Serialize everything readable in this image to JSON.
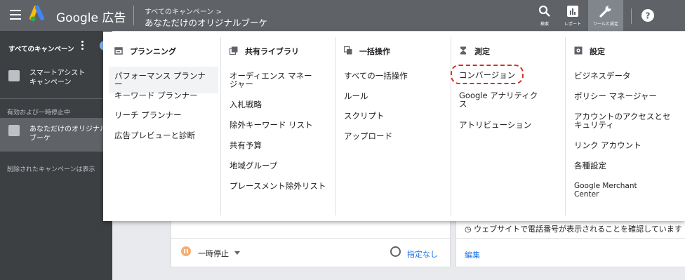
{
  "header": {
    "app_name": "Google 広告",
    "breadcrumb_parent": "すべてのキャンペーン >",
    "breadcrumb_current": "あなただけのオリジナルブーケ",
    "tools": [
      {
        "label": "検索",
        "icon": "search-icon"
      },
      {
        "label": "レポート",
        "icon": "bar-chart-icon"
      },
      {
        "label": "ツールと設定",
        "icon": "wrench-icon"
      }
    ],
    "help_icon": "help-icon"
  },
  "sidebar": {
    "all_campaigns": "すべてのキャンペーン",
    "smart_campaign": "スマートアシスト\nキャンペーン",
    "section_label": "有効および一時停止中",
    "campaign_name": "あなただけのオリジナル\nブーケ",
    "deleted_hidden": "削除されたキャンペーンは表示"
  },
  "background": {
    "pause_label": "一時停止",
    "schedule_label": "指定なし",
    "phone_notice": "◷ ウェブサイトで電話番号が表示されることを確認しています",
    "edit_link": "編集"
  },
  "menu": {
    "planning": {
      "title": "プランニング",
      "items": [
        "パフォーマンス プランナー",
        "キーワード プランナー",
        "リーチ プランナー",
        "広告プレビューと診断"
      ]
    },
    "shared_library": {
      "title": "共有ライブラリ",
      "items": [
        "オーディエンス マネー\nジャー",
        "入札戦略",
        "除外キーワード リスト",
        "共有予算",
        "地域グループ",
        "プレースメント除外リスト"
      ]
    },
    "bulk_actions": {
      "title": "一括操作",
      "items": [
        "すべての一括操作",
        "ルール",
        "スクリプト",
        "アップロード"
      ]
    },
    "measurement": {
      "title": "測定",
      "items": [
        "コンバージョン",
        "Google アナリティク\nス",
        "アトリビューション"
      ]
    },
    "settings": {
      "title": "設定",
      "items": [
        "ビジネスデータ",
        "ポリシー マネージャー",
        "アカウントのアクセスとセ\nキュリティ",
        "リンク アカウント",
        "各種設定",
        "Google Merchant\nCenter"
      ]
    }
  },
  "colors": {
    "topbar": "#5f6368",
    "sidebar": "#3c4043",
    "link": "#1a73e8",
    "highlight_circle": "#d93025"
  }
}
